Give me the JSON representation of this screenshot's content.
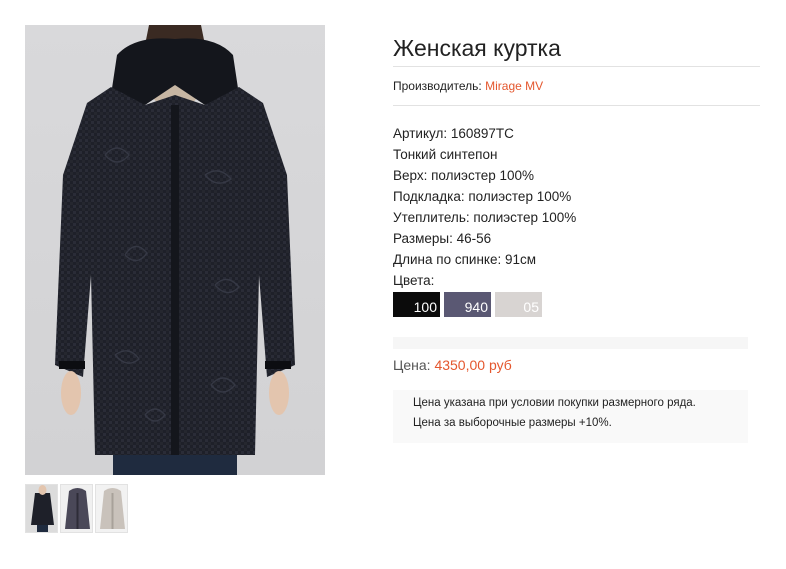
{
  "product": {
    "image_alt": "Женская куртка черная стеганая с капюшоном",
    "thumbnails": [
      {
        "name": "thumb-black"
      },
      {
        "name": "thumb-graphite"
      },
      {
        "name": "thumb-beige"
      }
    ],
    "title": "Женская куртка",
    "manufacturer_label": "Производитель:",
    "manufacturer_name": "Mirage MV",
    "specs": [
      "Артикул: 160897TC",
      "Тонкий синтепон",
      "Верх: полиэстер 100%",
      "Подкладка: полиэстер 100%",
      "Утеплитель: полиэстер 100%",
      "Размеры: 46-56",
      "Длина по спинке: 91см",
      "Цвета:"
    ],
    "colors": [
      {
        "code": "100",
        "hex": "#0b0b0b"
      },
      {
        "code": "940",
        "hex": "#5a5873"
      },
      {
        "code": "05",
        "hex": "#d8d4d2"
      }
    ],
    "price_label": "Цена:",
    "price_value": "4350,00 руб",
    "note_line1": "Цена указана при условии покупки размерного ряда.",
    "note_line2": "Цена за выборочные размеры +10%."
  },
  "theme": {
    "accent": "#e4572e"
  }
}
